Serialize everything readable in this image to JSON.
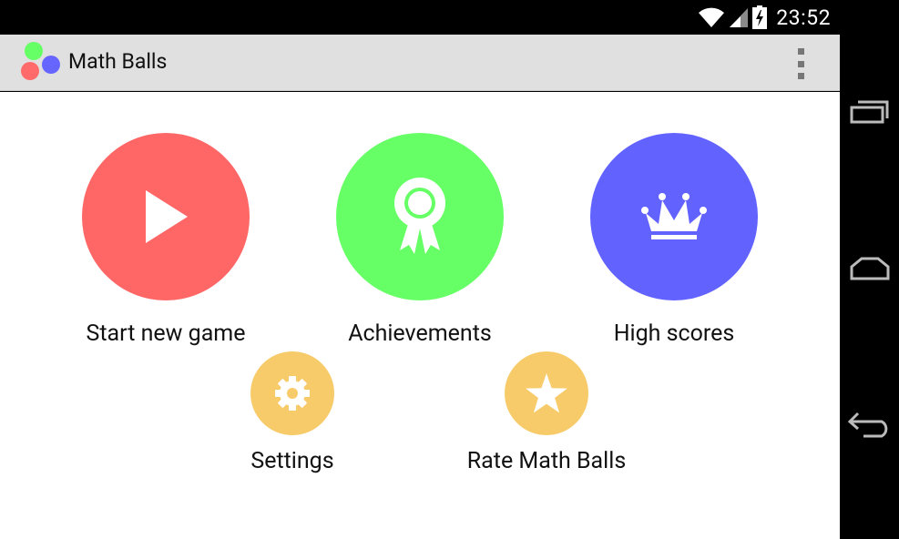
{
  "status_bar": {
    "time": "23:52",
    "icons": [
      "wifi-icon",
      "cell-signal-icon",
      "battery-charging-icon"
    ]
  },
  "action_bar": {
    "title": "Math Balls",
    "logo_colors": [
      "#66ff66",
      "#ff6b6b",
      "#6666ff"
    ],
    "overflow_icon": "overflow-menu-icon"
  },
  "menu": {
    "start_new_game": {
      "label": "Start new game",
      "color": "#ff6666",
      "icon": "play-icon"
    },
    "achievements": {
      "label": "Achievements",
      "color": "#66ff66",
      "icon": "award-ribbon-icon"
    },
    "high_scores": {
      "label": "High scores",
      "color": "#6262ff",
      "icon": "crown-icon"
    },
    "settings": {
      "label": "Settings",
      "color": "#f7cb69",
      "icon": "gear-icon"
    },
    "rate": {
      "label": "Rate Math Balls",
      "color": "#f7cb69",
      "icon": "star-icon"
    }
  },
  "nav_bar": {
    "buttons": [
      "recent-apps-icon",
      "home-icon",
      "back-icon"
    ]
  }
}
